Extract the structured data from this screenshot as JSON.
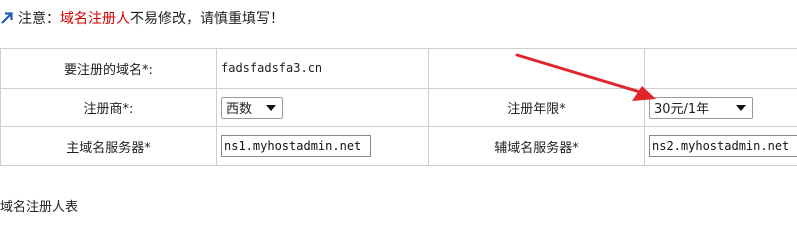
{
  "notice": {
    "prefix": "注意：",
    "highlight": "域名注册人",
    "suffix": "不易修改，请慎重填写！",
    "highlight_color": "#d40000",
    "icon": "arrow-up-right-icon"
  },
  "form": {
    "domain_label": "要注册的域名*:",
    "domain_value": "fadsfadsfa3.cn",
    "registrar_label": "注册商*:",
    "registrar_value": "西数",
    "years_label": "注册年限*",
    "years_value": "30元/1年",
    "ns1_label": "主域名服务器*",
    "ns1_value": "ns1.myhostadmin.net",
    "ns2_label": "辅域名服务器*",
    "ns2_value": "ns2.myhostadmin.net"
  },
  "footer": {
    "text": "域名注册人表"
  },
  "annotation": {
    "color": "#e0262b",
    "icon": "red-arrow-annotation"
  }
}
